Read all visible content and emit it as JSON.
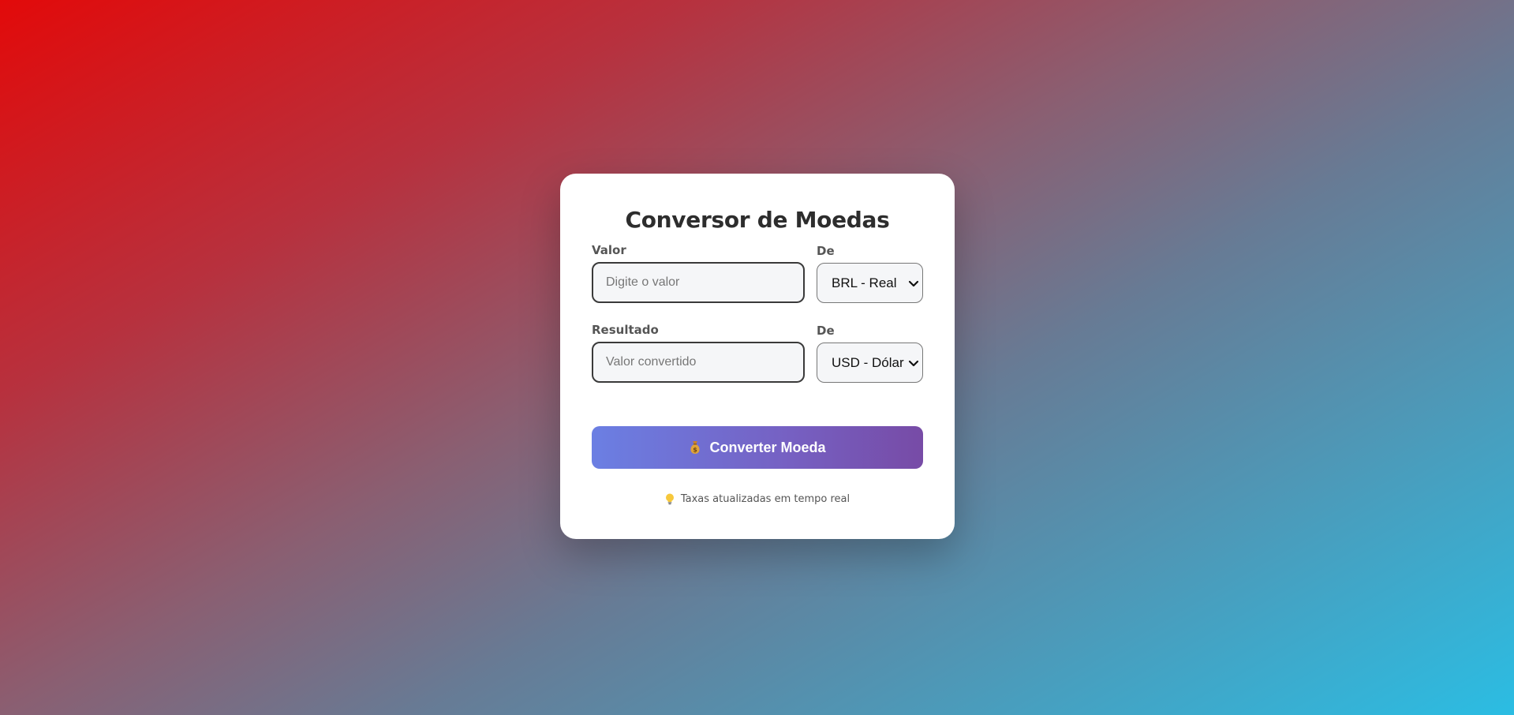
{
  "card": {
    "title": "Conversor de Moedas",
    "row1": {
      "amount_label": "Valor",
      "amount_placeholder": "Digite o valor",
      "amount_value": "",
      "currency_label": "De",
      "currency_selected": "BRL - Real"
    },
    "row2": {
      "result_label": "Resultado",
      "result_placeholder": "Valor convertido",
      "result_value": "",
      "currency_label": "De",
      "currency_selected": "USD - Dólar"
    },
    "convert_button": {
      "icon": "money-bag-icon",
      "label": "Converter Moeda"
    },
    "hint": {
      "icon": "light-bulb-icon",
      "text": "Taxas atualizadas em tempo real"
    }
  },
  "colors": {
    "background_start": "#e20a0a",
    "background_end": "#2bbde3",
    "button_start": "#6b7fe3",
    "button_end": "#774ba6"
  }
}
